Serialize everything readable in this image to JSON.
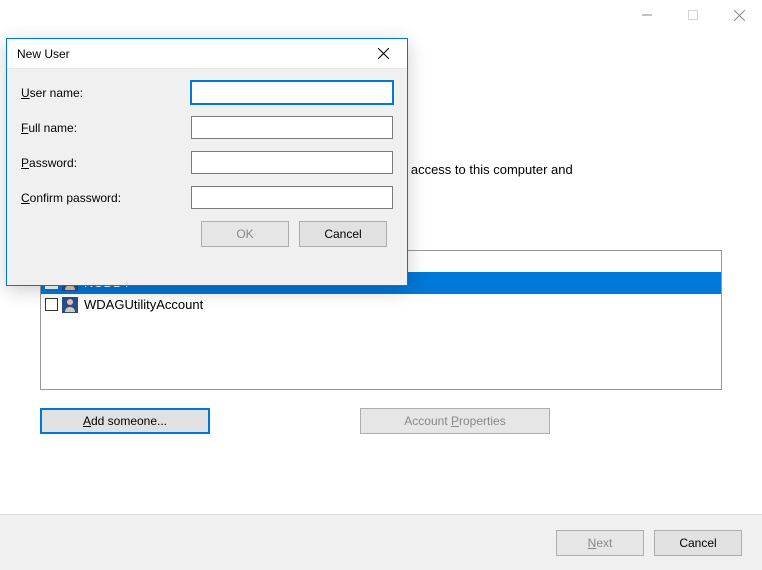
{
  "parent": {
    "description_text": "n access to this computer and",
    "users": [
      {
        "name": "",
        "selected": false,
        "cut": true
      },
      {
        "name": "NODDY",
        "selected": true
      },
      {
        "name": "WDAGUtilityAccount",
        "selected": false
      }
    ],
    "add_someone_label": "Add someone...",
    "account_properties_label": "Account Properties",
    "next_label": "Next",
    "cancel_label": "Cancel"
  },
  "modal": {
    "title": "New User",
    "username_label": "User name:",
    "fullname_label": "Full name:",
    "password_label": "Password:",
    "confirm_label": "Confirm password:",
    "username_value": "",
    "fullname_value": "",
    "password_value": "",
    "confirm_value": "",
    "ok_label": "OK",
    "cancel_label": "Cancel"
  }
}
